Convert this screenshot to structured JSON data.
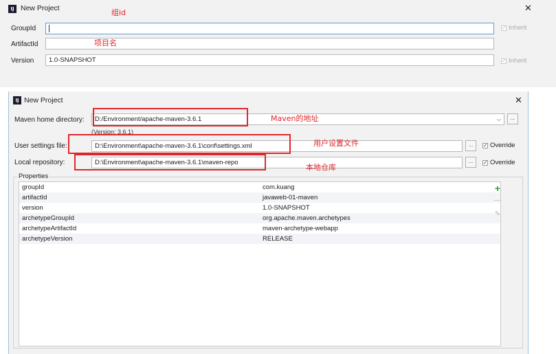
{
  "dialog1": {
    "title": "New Project",
    "title_icon": "intellij-icon",
    "close": "✕",
    "groupid_label": "GroupId",
    "groupid_value": "",
    "artifactid_label": "ArtifactId",
    "artifactid_value": "",
    "version_label": "Version",
    "version_value": "1.0-SNAPSHOT",
    "inherit_label": "Inherit",
    "annotations": {
      "groupid": "组id",
      "artifactid": "项目名"
    }
  },
  "dialog2": {
    "title": "New Project",
    "title_icon": "intellij-icon",
    "close": "✕",
    "maven_home_label": "Maven home directory:",
    "maven_home_value": "D:/Environment/apache-maven-3.6.1",
    "maven_version": "(Version: 3.6.1)",
    "browse": "...",
    "user_settings_label": "User settings file:",
    "user_settings_value": "D:\\Environment\\apache-maven-3.6.1\\conf\\settings.xml",
    "local_repo_label": "Local repository:",
    "local_repo_value": "D:\\Environment\\apache-maven-3.6.1\\maven-repo",
    "override_label": "Override",
    "annotations": {
      "maven_home": "Maven的地址",
      "user_settings": "用户设置文件",
      "local_repo": "本地仓库"
    },
    "properties_label": "Properties",
    "properties": [
      {
        "key": "groupId",
        "value": "com.kuang"
      },
      {
        "key": "artifactId",
        "value": "javaweb-01-maven"
      },
      {
        "key": "version",
        "value": "1.0-SNAPSHOT"
      },
      {
        "key": "archetypeGroupId",
        "value": "org.apache.maven.archetypes"
      },
      {
        "key": "archetypeArtifactId",
        "value": "maven-archetype-webapp"
      },
      {
        "key": "archetypeVersion",
        "value": "RELEASE"
      }
    ],
    "add_button": "+",
    "remove_button": "—",
    "edit_button": "✎"
  },
  "colors": {
    "annotation": "#e0252a",
    "focus": "#5e9ad8",
    "add": "#3a9a3a"
  }
}
